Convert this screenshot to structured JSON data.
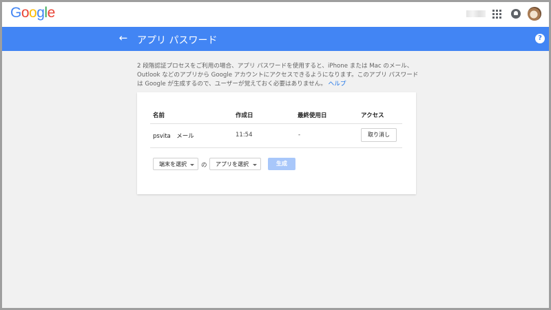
{
  "logo": {
    "text": "Google"
  },
  "header": {
    "title": "アプリ パスワード"
  },
  "description": {
    "text": "2 段階認証プロセスをご利用の場合、アプリ パスワードを使用すると、iPhone または Mac のメール、Outlook などのアプリから Google アカウントにアクセスできるようになります。このアプリ パスワードは Google が生成するので、ユーザーが覚えておく必要はありません。",
    "help_link": "ヘルプ"
  },
  "table": {
    "headers": {
      "name": "名前",
      "created": "作成日",
      "last_used": "最終使用日",
      "access": "アクセス"
    },
    "rows": [
      {
        "name": "psvita　メール",
        "created": "11:54",
        "last_used": "-",
        "action": "取り消し"
      }
    ]
  },
  "generator": {
    "device_select": "端末を選択",
    "of_label": "の",
    "app_select": "アプリを選択",
    "generate_button": "生成"
  },
  "colors": {
    "app_bar": "#4285f4",
    "link": "#1a73e8",
    "disabled_button": "#a8c7fa"
  },
  "icons": [
    "back-arrow-icon",
    "help-icon",
    "apps-grid-icon",
    "notifications-icon",
    "avatar"
  ]
}
